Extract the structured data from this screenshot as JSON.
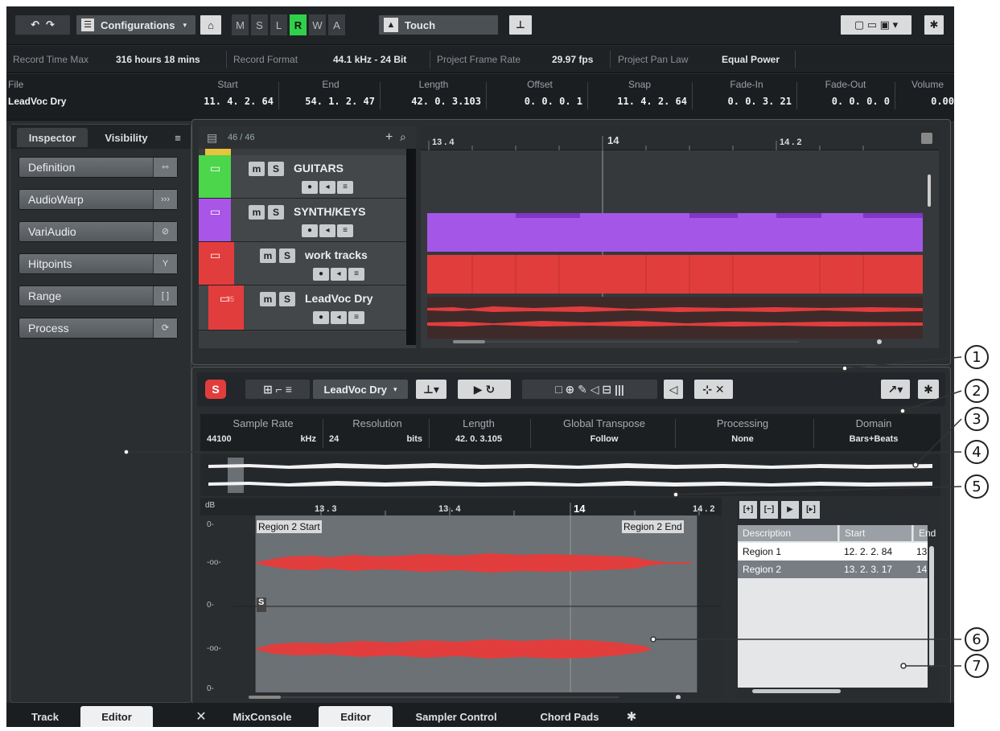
{
  "toolbar": {
    "configurations_label": "Configurations",
    "modes": [
      "M",
      "S",
      "L",
      "R",
      "W",
      "A"
    ],
    "active_mode": "R",
    "automation_mode": "Touch"
  },
  "status_line": {
    "record_time_label": "Record Time Max",
    "record_time_value": "316 hours 18 mins",
    "record_format_label": "Record Format",
    "record_format_value": "44.1 kHz - 24 Bit",
    "frame_rate_label": "Project Frame Rate",
    "frame_rate_value": "29.97 fps",
    "pan_law_label": "Project Pan Law",
    "pan_law_value": "Equal Power"
  },
  "event_info": {
    "file_label": "File",
    "file_value": "LeadVoc Dry",
    "columns": [
      {
        "label": "Start",
        "value": "11. 4. 2. 64"
      },
      {
        "label": "End",
        "value": "54. 1. 2. 47"
      },
      {
        "label": "Length",
        "value": "42. 0. 3.103"
      },
      {
        "label": "Offset",
        "value": "0. 0. 0. 1"
      },
      {
        "label": "Snap",
        "value": "11. 4. 2. 64"
      },
      {
        "label": "Fade-In",
        "value": "0. 0. 3. 21"
      },
      {
        "label": "Fade-Out",
        "value": "0. 0. 0. 0"
      },
      {
        "label": "Volume",
        "value": "0.00"
      }
    ]
  },
  "left_zone": {
    "tabs": [
      "Inspector",
      "Visibility"
    ],
    "menu_icon": "≡",
    "sections": [
      {
        "label": "Definition",
        "icon": "resize-icon"
      },
      {
        "label": "AudioWarp",
        "icon": "warp-icon"
      },
      {
        "label": "VariAudio",
        "icon": "vari-icon"
      },
      {
        "label": "Hitpoints",
        "icon": "hitpoint-icon"
      },
      {
        "label": "Range",
        "icon": "range-icon"
      },
      {
        "label": "Process",
        "icon": "process-icon"
      }
    ]
  },
  "track_list": {
    "count": "46 / 46",
    "tracks": [
      {
        "name": "GUITARS",
        "color": "#4cd64c"
      },
      {
        "name": "SYNTH/KEYS",
        "color": "#a855e8"
      },
      {
        "name": "work tracks",
        "color": "#e23d3d"
      },
      {
        "name": "LeadVoc Dry",
        "color": "#e23d3d",
        "number": "25"
      }
    ],
    "mute_label": "m",
    "solo_label": "S"
  },
  "project_ruler": {
    "marks": [
      "13 . 4",
      "14",
      "14 . 2"
    ]
  },
  "editor": {
    "event_name": "LeadVoc Dry",
    "info": [
      {
        "label": "Sample Rate",
        "value": "44100",
        "unit": "kHz"
      },
      {
        "label": "Resolution",
        "value": "24",
        "unit": "bits"
      },
      {
        "label": "Length",
        "value": "42. 0. 3.105",
        "unit": ""
      },
      {
        "label": "Global Transpose",
        "value": "Follow",
        "unit": ""
      },
      {
        "label": "Processing",
        "value": "None",
        "unit": ""
      },
      {
        "label": "Domain",
        "value": "Bars+Beats",
        "unit": ""
      }
    ],
    "ruler_marks": [
      "13 . 3",
      "13 . 4",
      "14",
      "14 . 2"
    ],
    "db_label": "dB",
    "scale_labels": [
      "0-",
      "-oo-",
      "0-",
      "-oo-",
      "0-"
    ],
    "region_start": "Region 2 Start",
    "region_end": "Region 2 End",
    "s_marker": "S"
  },
  "regions": {
    "headers": [
      "Description",
      "Start",
      "End"
    ],
    "rows": [
      {
        "description": "Region 1",
        "start": "12. 2. 2. 84",
        "end": "13",
        "selected": false
      },
      {
        "description": "Region 2",
        "start": "13. 2. 3. 17",
        "end": "14",
        "selected": true
      }
    ]
  },
  "bottom_tabs": {
    "left": [
      "Track",
      "Editor"
    ],
    "right": [
      "MixConsole",
      "Editor",
      "Sampler Control",
      "Chord Pads"
    ],
    "active_left": "Editor",
    "active_right": "Editor"
  },
  "callouts": [
    "1",
    "2",
    "3",
    "4",
    "5",
    "6",
    "7"
  ]
}
